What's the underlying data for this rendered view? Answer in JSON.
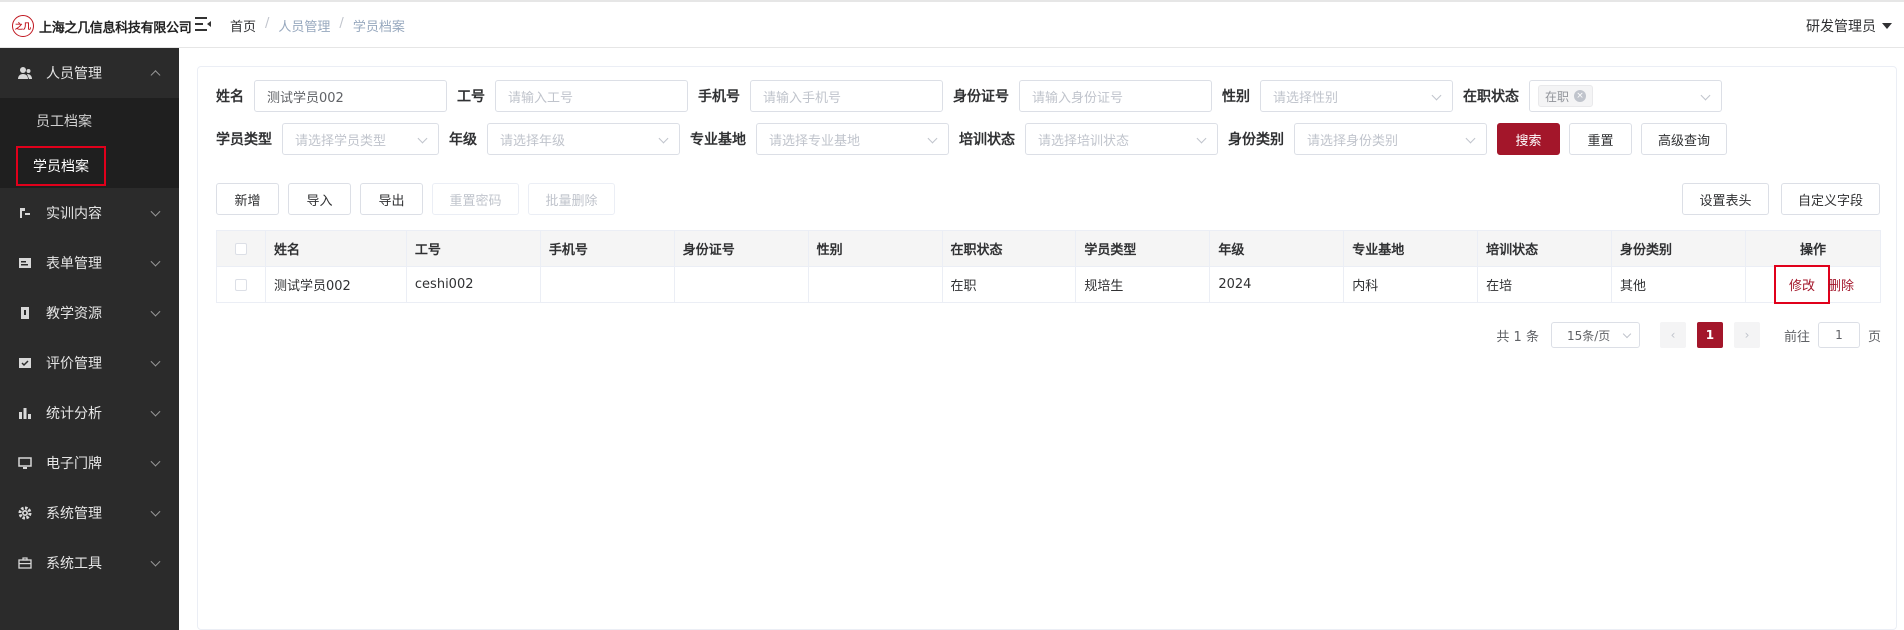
{
  "header": {
    "logo_mark": "之几",
    "company": "上海之几信息科技有限公司",
    "breadcrumb": [
      "首页",
      "人员管理",
      "学员档案"
    ],
    "user": "研发管理员"
  },
  "sidebar": {
    "items": [
      {
        "label": "人员管理",
        "icon": "users-icon",
        "open": true
      },
      {
        "label": "实训内容",
        "icon": "training-icon"
      },
      {
        "label": "表单管理",
        "icon": "form-icon"
      },
      {
        "label": "教学资源",
        "icon": "book-icon"
      },
      {
        "label": "评价管理",
        "icon": "evaluation-icon"
      },
      {
        "label": "统计分析",
        "icon": "chart-icon"
      },
      {
        "label": "电子门牌",
        "icon": "monitor-icon"
      },
      {
        "label": "系统管理",
        "icon": "gear-icon"
      },
      {
        "label": "系统工具",
        "icon": "toolbox-icon"
      }
    ],
    "sub": [
      "员工档案",
      "学员档案"
    ]
  },
  "filters": {
    "name_label": "姓名",
    "name_value": "测试学员002",
    "job_label": "工号",
    "job_ph": "请输入工号",
    "phone_label": "手机号",
    "phone_ph": "请输入手机号",
    "id_label": "身份证号",
    "id_ph": "请输入身份证号",
    "gender_label": "性别",
    "gender_ph": "请选择性别",
    "status_label": "在职状态",
    "status_tag": "在职",
    "stype_label": "学员类型",
    "stype_ph": "请选择学员类型",
    "grade_label": "年级",
    "grade_ph": "请选择年级",
    "base_label": "专业基地",
    "base_ph": "请选择专业基地",
    "train_label": "培训状态",
    "train_ph": "请选择培训状态",
    "idtype_label": "身份类别",
    "idtype_ph": "请选择身份类别",
    "search": "搜索",
    "reset": "重置",
    "advanced": "高级查询"
  },
  "toolbar": {
    "add": "新增",
    "import": "导入",
    "export": "导出",
    "reset_pwd": "重置密码",
    "batch_delete": "批量删除",
    "set_header": "设置表头",
    "custom_fields": "自定义字段"
  },
  "table": {
    "headers": [
      "姓名",
      "工号",
      "手机号",
      "身份证号",
      "性别",
      "在职状态",
      "学员类型",
      "年级",
      "专业基地",
      "培训状态",
      "身份类别",
      "操作"
    ],
    "rows": [
      {
        "cells": [
          "测试学员002",
          "ceshi002",
          "",
          "",
          "",
          "在职",
          "规培生",
          "2024",
          "内科",
          "在培",
          "其他"
        ],
        "edit": "修改",
        "del": "删除"
      }
    ]
  },
  "pager": {
    "total": "共 1 条",
    "size": "15条/页",
    "current": "1",
    "goto_prefix": "前往",
    "goto_value": "1",
    "goto_suffix": "页"
  },
  "colors": {
    "accent": "#a3162a",
    "sidebar": "#2b2b2b",
    "highlight": "#e0001b"
  }
}
